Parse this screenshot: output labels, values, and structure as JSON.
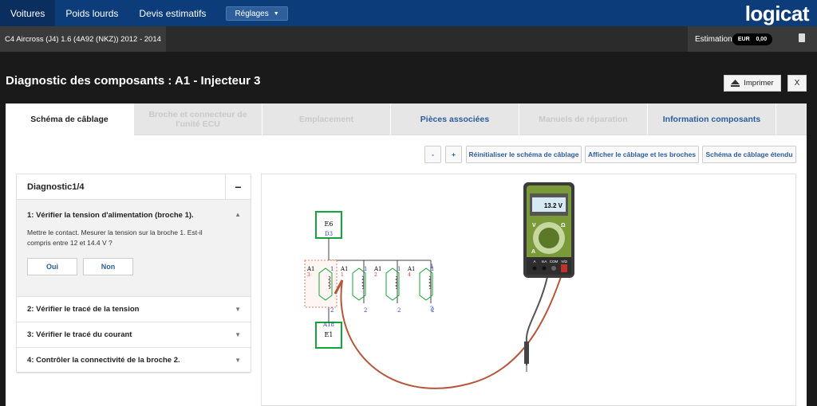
{
  "nav": {
    "items": [
      "Voitures",
      "Poids lourds",
      "Devis estimatifs"
    ],
    "settings": "Réglages",
    "logo": "logicat"
  },
  "vehicle": "C4 Aircross (J4) 1.6 (4A92 (NKZ)) 2012 - 2014",
  "estimation": {
    "label": "Estimation",
    "currency": "EUR",
    "amount": "0,00"
  },
  "page": {
    "title": "Diagnostic des composants : A1 - Injecteur 3",
    "print": "Imprimer",
    "close": "X"
  },
  "tabs": [
    {
      "label": "Schéma de câblage",
      "state": "active"
    },
    {
      "label": "Broche et connecteur de l'unité ECU",
      "state": "disabled"
    },
    {
      "label": "Emplacement",
      "state": "disabled"
    },
    {
      "label": "Pièces associées",
      "state": "link"
    },
    {
      "label": "Manuels de réparation",
      "state": "disabled"
    },
    {
      "label": "Information composants",
      "state": "link"
    }
  ],
  "toolbar": {
    "zoom_out": "-",
    "zoom_in": "+",
    "reset": "Réinitialiser le schéma de câblage",
    "show": "Afficher le câblage et les broches",
    "extended": "Schéma de câblage étendu"
  },
  "diag": {
    "title": "Diagnostic1/4",
    "open_step": {
      "title": "1: Vérifier la tension d'alimentation (broche 1).",
      "text": "Mettre le contact. Mesurer la tension sur la broche 1. Est-il compris entre 12 et 14.4 V ?",
      "yes": "Oui",
      "no": "Non"
    },
    "steps": [
      "2: Vérifier le tracé de la tension",
      "3: Vérifier le tracé du courant",
      "4: Contrôler la connectivité de la broche 2."
    ]
  },
  "wiring": {
    "top_box": "E6",
    "top_pin": "D3",
    "bottom_box": "E1",
    "bottom_pin": "A18",
    "injectors": [
      {
        "name": "A1",
        "num": "3",
        "pin_top": "1",
        "pin_bottom": "2"
      },
      {
        "name": "A1",
        "num": "1",
        "pin_top": "1",
        "pin_bottom": "2"
      },
      {
        "name": "A1",
        "num": "2",
        "pin_top": "1",
        "pin_bottom": "2"
      },
      {
        "name": "A1",
        "num": "4",
        "pin_top": "1",
        "pin_bottom": "2"
      }
    ],
    "extra_pin_top": "1",
    "extra_pin_bottom": "2"
  },
  "meter": {
    "reading": "13.2 V",
    "v_label": "V",
    "ohm_label": "Ω",
    "a_label": "A",
    "ports": [
      "A",
      "mA",
      "COM",
      "V/Ω"
    ]
  },
  "colors": {
    "nav": "#0c3d7a",
    "link": "#2b5d9c",
    "box": "#13a538",
    "probe": "#b5563a"
  }
}
